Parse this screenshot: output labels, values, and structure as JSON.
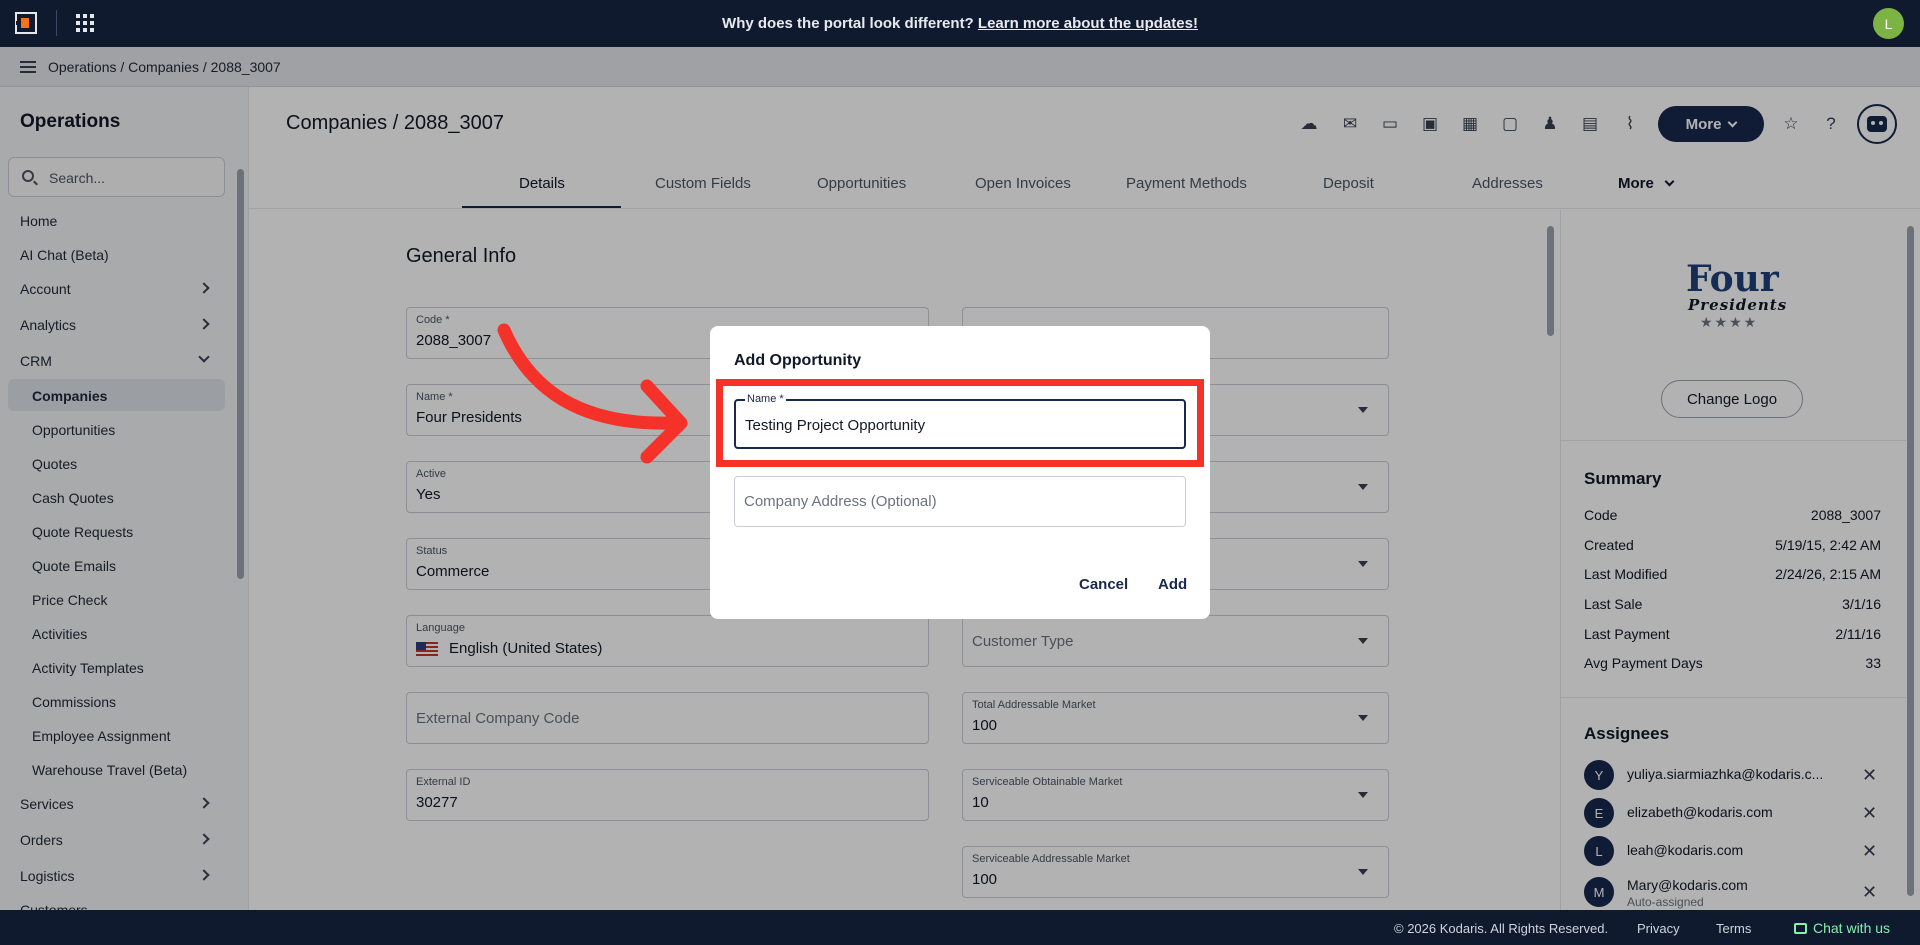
{
  "topbar": {
    "banner_text": "Why does the portal look different?",
    "banner_link": "Learn more about the updates!",
    "user_initial": "L"
  },
  "breadcrumb": "Operations / Companies / 2088_3007",
  "sidebar": {
    "title": "Operations",
    "search_placeholder": "Search...",
    "items": [
      {
        "label": "Home"
      },
      {
        "label": "AI Chat (Beta)"
      },
      {
        "label": "Account"
      },
      {
        "label": "Analytics"
      },
      {
        "label": "CRM"
      },
      {
        "label": "Services"
      },
      {
        "label": "Orders"
      },
      {
        "label": "Logistics"
      },
      {
        "label": "Customers"
      }
    ],
    "crm_items": [
      {
        "label": "Companies"
      },
      {
        "label": "Opportunities"
      },
      {
        "label": "Quotes"
      },
      {
        "label": "Cash Quotes"
      },
      {
        "label": "Quote Requests"
      },
      {
        "label": "Quote Emails"
      },
      {
        "label": "Price Check"
      },
      {
        "label": "Activities"
      },
      {
        "label": "Activity Templates"
      },
      {
        "label": "Commissions"
      },
      {
        "label": "Employee Assignment"
      },
      {
        "label": "Warehouse Travel (Beta)"
      }
    ]
  },
  "header": {
    "title": "Companies / 2088_3007",
    "more_label": "More"
  },
  "tabs": [
    {
      "label": "Details"
    },
    {
      "label": "Custom Fields"
    },
    {
      "label": "Opportunities"
    },
    {
      "label": "Open Invoices"
    },
    {
      "label": "Payment Methods"
    },
    {
      "label": "Deposit"
    },
    {
      "label": "Addresses"
    },
    {
      "label": "More"
    }
  ],
  "form": {
    "title": "General Info",
    "code": {
      "label": "Code *",
      "value": "2088_3007"
    },
    "name": {
      "label": "Name *",
      "value": "Four Presidents"
    },
    "active": {
      "label": "Active",
      "value": "Yes"
    },
    "status": {
      "label": "Status",
      "value": "Commerce"
    },
    "language": {
      "label": "Language",
      "value": "English (United States)"
    },
    "external_company_code": {
      "placeholder": "External Company Code"
    },
    "external_id": {
      "label": "External ID",
      "value": "30277"
    },
    "customer_type": {
      "placeholder": "Customer Type"
    },
    "tam": {
      "label": "Total Addressable Market",
      "value": "100"
    },
    "som": {
      "label": "Serviceable Obtainable Market",
      "value": "10"
    },
    "sam": {
      "label": "Serviceable Addressable Market",
      "value": "100"
    }
  },
  "right_panel": {
    "logo_line1": "Four",
    "logo_line2": "Presidents",
    "logo_stars": "★★★★",
    "change_logo": "Change Logo",
    "summary_title": "Summary",
    "summary": [
      {
        "label": "Code",
        "value": "2088_3007"
      },
      {
        "label": "Created",
        "value": "5/19/15, 2:42 AM"
      },
      {
        "label": "Last Modified",
        "value": "2/24/26, 2:15 AM"
      },
      {
        "label": "Last Sale",
        "value": "3/1/16"
      },
      {
        "label": "Last Payment",
        "value": "2/11/16"
      },
      {
        "label": "Avg Payment Days",
        "value": "33"
      }
    ],
    "assignees_title": "Assignees",
    "assignees": [
      {
        "initial": "Y",
        "email": "yuliya.siarmiazhka@kodaris.c...",
        "note": ""
      },
      {
        "initial": "E",
        "email": "elizabeth@kodaris.com",
        "note": ""
      },
      {
        "initial": "L",
        "email": "leah@kodaris.com",
        "note": ""
      },
      {
        "initial": "M",
        "email": "Mary@kodaris.com",
        "note": "Auto-assigned"
      }
    ]
  },
  "modal": {
    "title": "Add Opportunity",
    "name_label": "Name *",
    "name_value": "Testing Project Opportunity",
    "address_placeholder": "Company Address (Optional)",
    "cancel_label": "Cancel",
    "add_label": "Add"
  },
  "footer": {
    "copyright": "© 2026 Kodaris. All Rights Reserved.",
    "privacy": "Privacy",
    "terms": "Terms",
    "chat": "Chat with us"
  },
  "colors": {
    "navy": "#17294d",
    "highlight_red": "#f4322a",
    "topbar": "#0f1a2f"
  }
}
